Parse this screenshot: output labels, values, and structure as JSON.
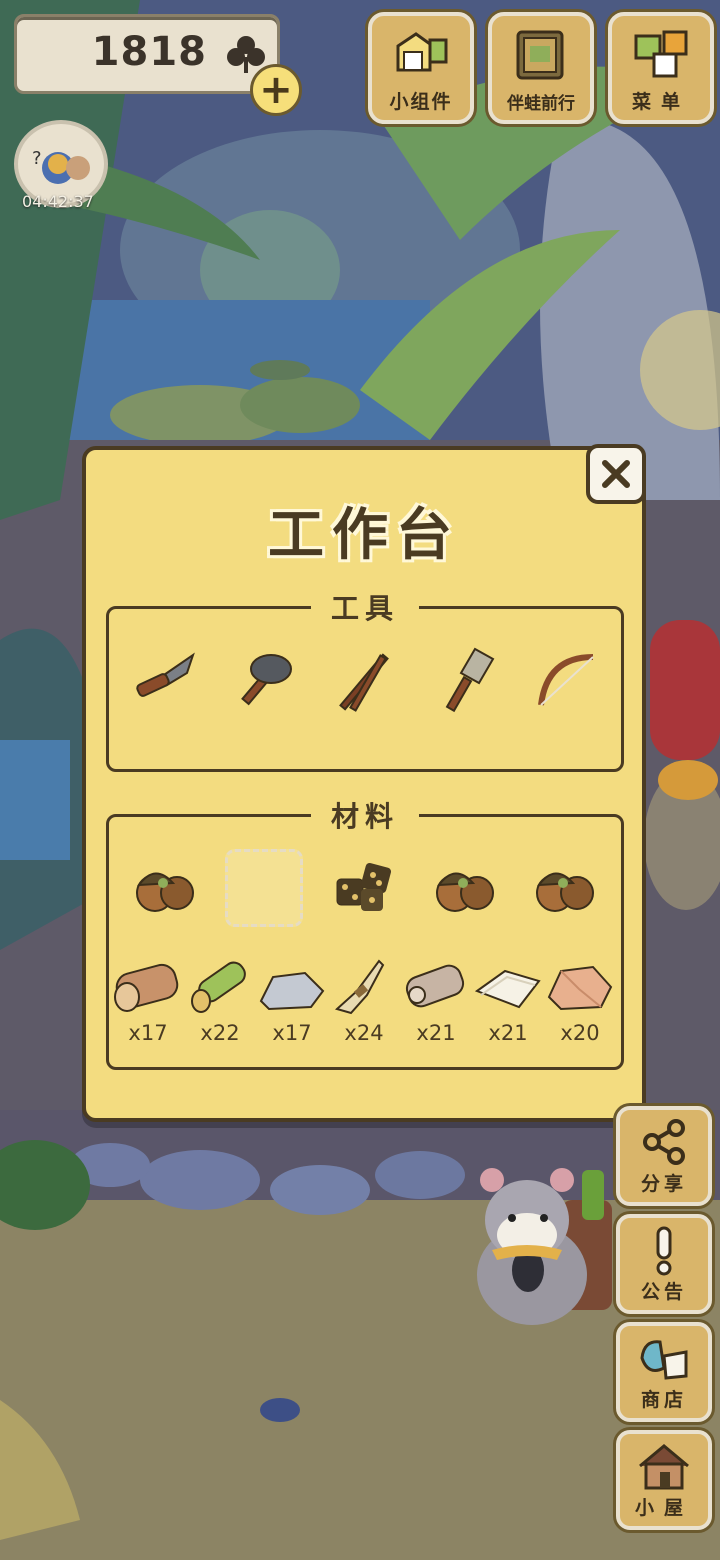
{
  "currency": {
    "amount": "1818"
  },
  "top_buttons": [
    {
      "label": "小组件",
      "icon": "widget-icon"
    },
    {
      "label": "伴蛙前行",
      "icon": "journal-icon"
    },
    {
      "label": "菜单",
      "icon": "menu-icon"
    }
  ],
  "timer": {
    "text": "04:42:37"
  },
  "dialog": {
    "title": "工作台",
    "tools_label": "工具",
    "materials_label": "材料",
    "tools": [
      {
        "icon": "knife-icon"
      },
      {
        "icon": "stone-axe-icon"
      },
      {
        "icon": "sticks-icon"
      },
      {
        "icon": "brush-icon"
      },
      {
        "icon": "bow-icon"
      }
    ],
    "materials_top": [
      {
        "icon": "acorns-icon"
      },
      {
        "icon": "empty-slot"
      },
      {
        "icon": "dice-icon"
      },
      {
        "icon": "acorns-icon"
      },
      {
        "icon": "acorns-icon"
      }
    ],
    "materials_bottom": [
      {
        "icon": "wood-log-icon",
        "count": "x17"
      },
      {
        "icon": "bamboo-icon",
        "count": "x22"
      },
      {
        "icon": "stone-icon",
        "count": "x17"
      },
      {
        "icon": "straw-icon",
        "count": "x24"
      },
      {
        "icon": "cloth-roll-icon",
        "count": "x21"
      },
      {
        "icon": "paper-icon",
        "count": "x21"
      },
      {
        "icon": "copper-ore-icon",
        "count": "x20"
      }
    ]
  },
  "side_buttons": [
    {
      "label": "分享",
      "icon": "share-icon"
    },
    {
      "label": "公告",
      "icon": "notice-icon"
    },
    {
      "label": "商店",
      "icon": "shop-icon"
    },
    {
      "label": "小屋",
      "icon": "house-icon"
    }
  ],
  "colors": {
    "panel": "#f3dc80",
    "outline": "#4a3b22",
    "button": "#d9b56a"
  }
}
